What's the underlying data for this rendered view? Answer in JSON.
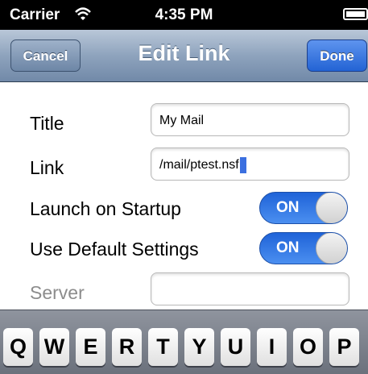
{
  "status_bar": {
    "carrier": "Carrier",
    "time": "4:35 PM",
    "wifi_icon": "wifi-icon",
    "battery_icon": "battery-icon"
  },
  "nav": {
    "cancel_label": "Cancel",
    "title": "Edit Link",
    "done_label": "Done"
  },
  "form": {
    "title_label": "Title",
    "title_value": "My Mail",
    "link_label": "Link",
    "link_value": "/mail/ptest.nsf",
    "launch_label": "Launch on Startup",
    "launch_toggle": "ON",
    "default_label": "Use Default Settings",
    "default_toggle": "ON",
    "server_label": "Server",
    "server_value": ""
  },
  "keyboard": {
    "keys": [
      "Q",
      "W",
      "E",
      "R",
      "T",
      "Y",
      "U",
      "I",
      "O",
      "P"
    ]
  },
  "colors": {
    "nav_gradient_top": "#b9c7d8",
    "done_button": "#2363d4",
    "toggle_on": "#1f63d8"
  }
}
